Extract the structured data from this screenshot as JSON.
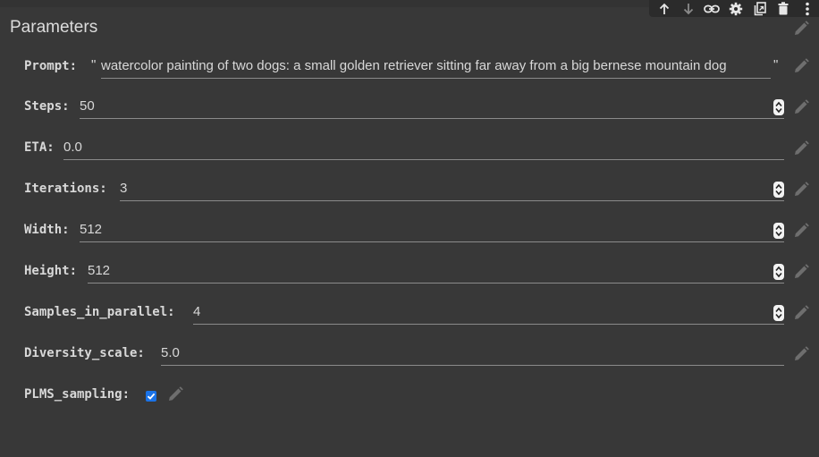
{
  "section": {
    "title": "Parameters"
  },
  "toolbar": {
    "icons": [
      "arrow-up-icon",
      "arrow-down-icon",
      "link-icon",
      "gear-icon",
      "mirror-cell-icon",
      "trash-icon",
      "more-vert-icon"
    ]
  },
  "fields": {
    "prompt": {
      "label": "Prompt:",
      "open_quote": "\"",
      "close_quote": "\"",
      "value": "watercolor painting of two dogs: a small golden retriever sitting far away from a big bernese mountain dog"
    },
    "steps": {
      "label": "Steps:",
      "value": "50"
    },
    "eta": {
      "label": "ETA:",
      "value": "0.0"
    },
    "iterations": {
      "label": "Iterations:",
      "value": "3"
    },
    "width": {
      "label": "Width:",
      "value": "512"
    },
    "height": {
      "label": "Height:",
      "value": "512"
    },
    "samples_in_parallel": {
      "label": "Samples_in_parallel:",
      "value": "4"
    },
    "diversity_scale": {
      "label": "Diversity_scale:",
      "value": "5.0"
    },
    "plms_sampling": {
      "label": "PLMS_sampling:",
      "checked": true
    }
  },
  "colors": {
    "background": "#383838",
    "checkbox_accent": "#1a73e8"
  }
}
